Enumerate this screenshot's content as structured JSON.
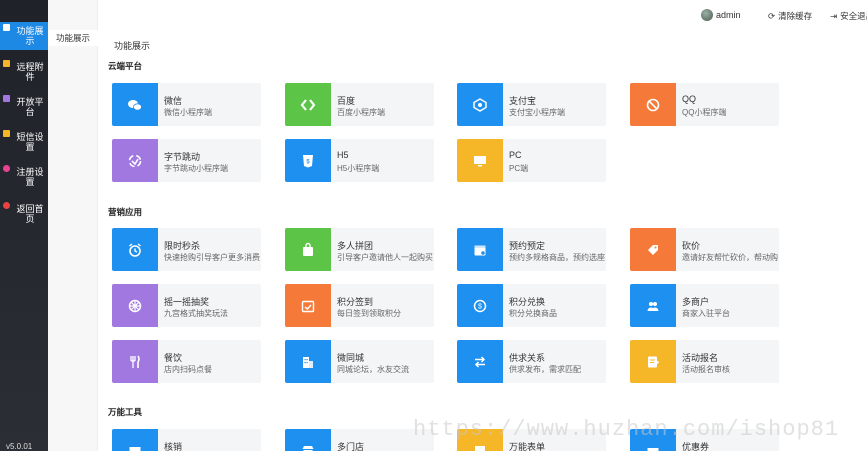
{
  "sidebar": {
    "items": [
      {
        "label": "功能展示",
        "color": "#ffffff"
      },
      {
        "label": "远程附件",
        "color": "#f5b628"
      },
      {
        "label": "开放平台",
        "color": "#a178e0"
      },
      {
        "label": "短信设置",
        "color": "#f5b628"
      },
      {
        "label": "注册设置",
        "color": "#e84393"
      },
      {
        "label": "返回首页",
        "color": "#e84343"
      }
    ],
    "version": "v5.0.01"
  },
  "subnav": {
    "item": "功能展示"
  },
  "header": {
    "user": "admin",
    "clear_cache": "清除缓存",
    "exit": "安全退出"
  },
  "breadcrumb": "功能展示",
  "sections": {
    "cloud": "云端平台",
    "marketing": "营销应用",
    "tools": "万能工具"
  },
  "cards": [
    {
      "title": "微信",
      "desc": "微信小程序端",
      "icon": "wechat-icon"
    },
    {
      "title": "百度",
      "desc": "百度小程序端",
      "icon": "baidu-icon"
    },
    {
      "title": "支付宝",
      "desc": "支付宝小程序端",
      "icon": "alipay-icon"
    },
    {
      "title": "QQ",
      "desc": "QQ小程序端",
      "icon": "qq-icon"
    },
    {
      "title": "字节跳动",
      "desc": "字节跳动小程序端",
      "icon": "bytedance-icon"
    },
    {
      "title": "H5",
      "desc": "H5小程序端",
      "icon": "h5-icon"
    },
    {
      "title": "PC",
      "desc": "PC端",
      "icon": "pc-icon"
    },
    {
      "title": "限时秒杀",
      "desc": "快速抢购引导客户更多消费",
      "icon": "alarm-icon"
    },
    {
      "title": "多人拼团",
      "desc": "引导客户邀请他人一起购买",
      "icon": "group-icon"
    },
    {
      "title": "预约预定",
      "desc": "预约多规格商品，预约选座",
      "icon": "calendar-icon"
    },
    {
      "title": "砍价",
      "desc": "邀请好友帮忙砍价，帮动购买",
      "icon": "tag-icon"
    },
    {
      "title": "摇一摇抽奖",
      "desc": "九宫格式抽奖玩法",
      "icon": "wheel-icon"
    },
    {
      "title": "积分签到",
      "desc": "每日签到领取积分",
      "icon": "checkin-icon"
    },
    {
      "title": "积分兑换",
      "desc": "积分兑换商品",
      "icon": "coin-icon"
    },
    {
      "title": "多商户",
      "desc": "商家入驻平台",
      "icon": "merchant-icon"
    },
    {
      "title": "餐饮",
      "desc": "店内扫码点餐",
      "icon": "cutlery-icon"
    },
    {
      "title": "微同城",
      "desc": "同城论坛，水友交流",
      "icon": "city-icon"
    },
    {
      "title": "供求关系",
      "desc": "供求发布，需求匹配",
      "icon": "exchange-icon"
    },
    {
      "title": "活动报名",
      "desc": "活动报名审核",
      "icon": "form-icon"
    },
    {
      "title": "核销",
      "desc": "",
      "icon": "verify-icon"
    },
    {
      "title": "多门店",
      "desc": "",
      "icon": "store-icon"
    },
    {
      "title": "万能表单",
      "desc": "",
      "icon": "universal-form-icon"
    },
    {
      "title": "优惠券",
      "desc": "",
      "icon": "coupon-icon"
    }
  ],
  "watermark": "https://www.huzhan.com/ishop81"
}
